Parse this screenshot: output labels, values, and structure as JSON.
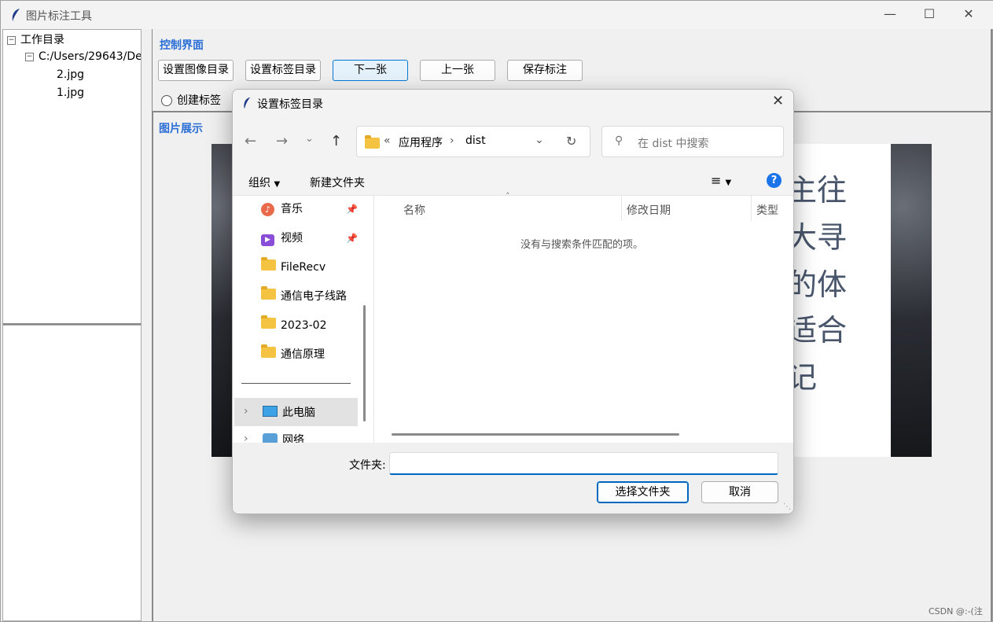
{
  "window": {
    "title": "图片标注工具"
  },
  "tree": {
    "root": "工作目录",
    "folder": "C:/Users/29643/Des",
    "files": [
      "2.jpg",
      "1.jpg"
    ]
  },
  "control": {
    "title": "控制界面",
    "buttons": [
      "设置图像目录",
      "设置标签目录",
      "下一张",
      "上一张",
      "保存标注"
    ],
    "radio_label": "创建标签"
  },
  "display": {
    "title": "图片展示",
    "text_lines": [
      "主往",
      "大寻",
      "的体",
      "适合",
      "记"
    ]
  },
  "dialog": {
    "title": "设置标签目录",
    "path": [
      "应用程序",
      "dist"
    ],
    "search_placeholder": "在 dist 中搜索",
    "toolbar": {
      "organize": "组织",
      "new_folder": "新建文件夹"
    },
    "nav_items": [
      {
        "label": "音乐",
        "icon": "music-icon",
        "pinned": true
      },
      {
        "label": "视频",
        "icon": "video-icon",
        "pinned": true
      },
      {
        "label": "FileRecv",
        "icon": "folder-icon"
      },
      {
        "label": "通信电子线路",
        "icon": "folder-icon"
      },
      {
        "label": "2023-02",
        "icon": "folder-icon"
      },
      {
        "label": "通信原理",
        "icon": "folder-icon"
      }
    ],
    "tree_items": [
      {
        "label": "此电脑",
        "icon": "computer-icon",
        "selected": true
      },
      {
        "label": "网络",
        "icon": "network-icon"
      }
    ],
    "columns": [
      "名称",
      "修改日期",
      "类型"
    ],
    "empty_message": "没有与搜索条件匹配的项。",
    "folder_label": "文件夹:",
    "folder_value": "",
    "select_button": "选择文件夹",
    "cancel_button": "取消"
  },
  "watermark": "CSDN @:-(注"
}
